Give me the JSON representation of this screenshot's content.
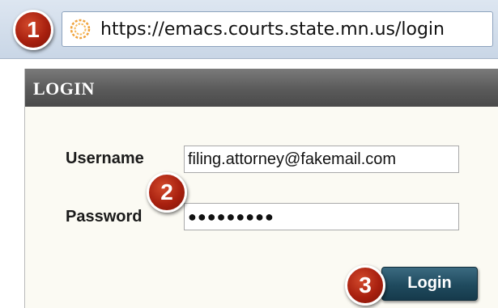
{
  "browser": {
    "url": "https://emacs.courts.state.mn.us/login",
    "site_icon": "site-favicon-ring-icon"
  },
  "steps": [
    "1",
    "2",
    "3"
  ],
  "login": {
    "title": "LOGIN",
    "username_label": "Username",
    "username_value": "filing.attorney@fakemail.com",
    "password_label": "Password",
    "password_value": "●●●●●●●●●",
    "button_label": "Login"
  },
  "colors": {
    "step_marker": "#a8200f",
    "header": "#5a5a5a",
    "button": "#1f4a5e"
  }
}
